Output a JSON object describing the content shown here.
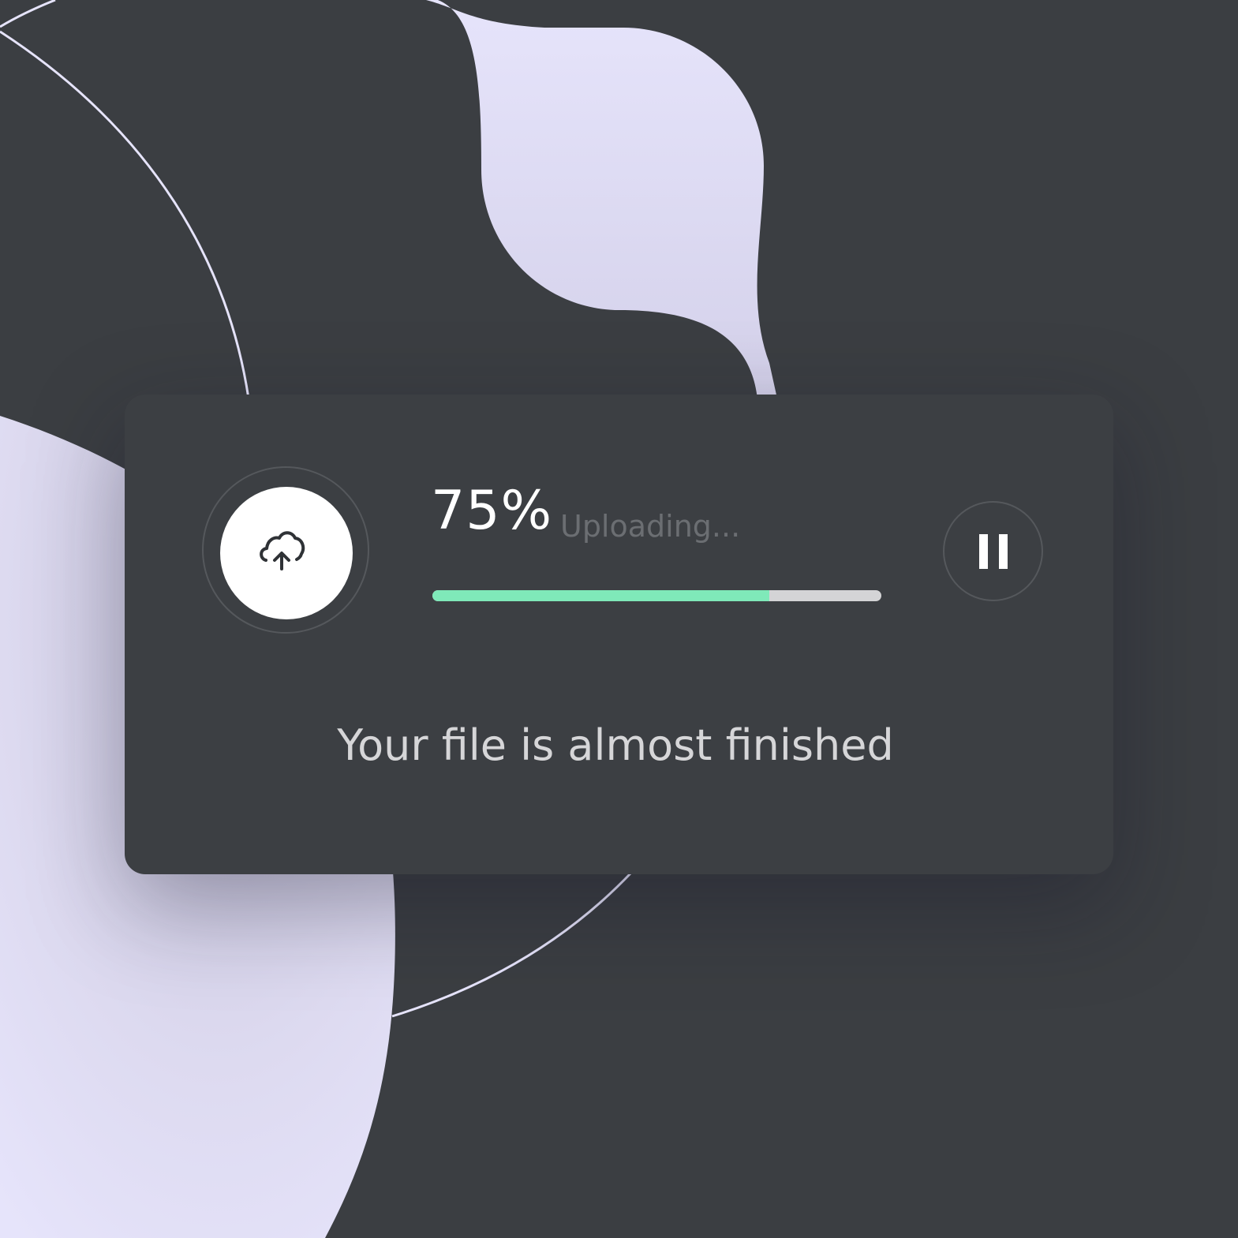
{
  "colors": {
    "background": "#3b3e42",
    "card": "#3c3f43",
    "accent_lavender": "#e6e4fb",
    "progress_fill": "#7fe9b9",
    "progress_track": "#d4d4d6"
  },
  "upload": {
    "icon": "cloud-upload-icon",
    "percent_text": "75%",
    "status_text": "Uploading...",
    "progress_fraction": 0.75
  },
  "controls": {
    "pause_icon": "pause-icon"
  },
  "message": "Your file is almost finished"
}
